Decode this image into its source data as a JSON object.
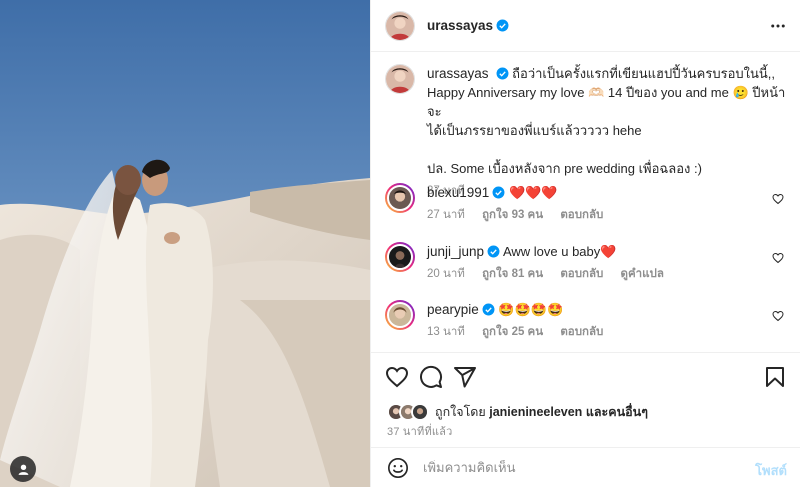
{
  "colors": {
    "verified": "#0095f6",
    "heart": "#ed4956",
    "muted": "#8e8e8e",
    "post_button": "#b2dffc",
    "sky": "#4f7fb8",
    "sand": "#e9e0d6"
  },
  "header": {
    "username": "urassayas",
    "more_icon": "more-horizontal-icon"
  },
  "caption": {
    "username": "urassayas",
    "line1": "ถือว่าเป็นครั้งแรกที่เขียนแฮปปี้วันครบรอบในนี้,,",
    "line2": "Happy Anniversary my love 🫶🏻 14 ปีของ you and me 🥲 ปีหน้าจะ",
    "line3": "ได้เป็นภรรยาของพี่แบร์แล้ววววว hehe",
    "line4": "ปล. Some เบื้องหลังจาก pre wedding เพื่อฉลอง :)",
    "time": "37 นาที"
  },
  "comments": [
    {
      "username": "biexu1991",
      "verified": true,
      "text": "❤️❤️❤️",
      "time": "27 นาที",
      "likes": "ถูกใจ 93 คน",
      "reply": "ตอบกลับ",
      "translate": ""
    },
    {
      "username": "junji_junp",
      "verified": true,
      "text": "Aww love u baby❤️",
      "time": "20 นาที",
      "likes": "ถูกใจ 81 คน",
      "reply": "ตอบกลับ",
      "translate": "ดูคำแปล"
    },
    {
      "username": "pearypie",
      "verified": true,
      "text": "🤩🤩🤩🤩",
      "time": "13 นาที",
      "likes": "ถูกใจ 25 คน",
      "reply": "ตอบกลับ",
      "translate": ""
    }
  ],
  "actions": {
    "like_icon": "heart-icon",
    "comment_icon": "comment-icon",
    "share_icon": "share-icon",
    "save_icon": "bookmark-icon"
  },
  "likes": {
    "prefix": "ถูกใจโดย",
    "user": "janienineeleven",
    "suffix": "และคนอื่นๆ"
  },
  "time_ago": "37 นาทีที่แล้ว",
  "comment_box": {
    "placeholder": "เพิ่มความคิดเห็น",
    "post_label": "โพสต์",
    "emoji_icon": "smiley-icon"
  }
}
